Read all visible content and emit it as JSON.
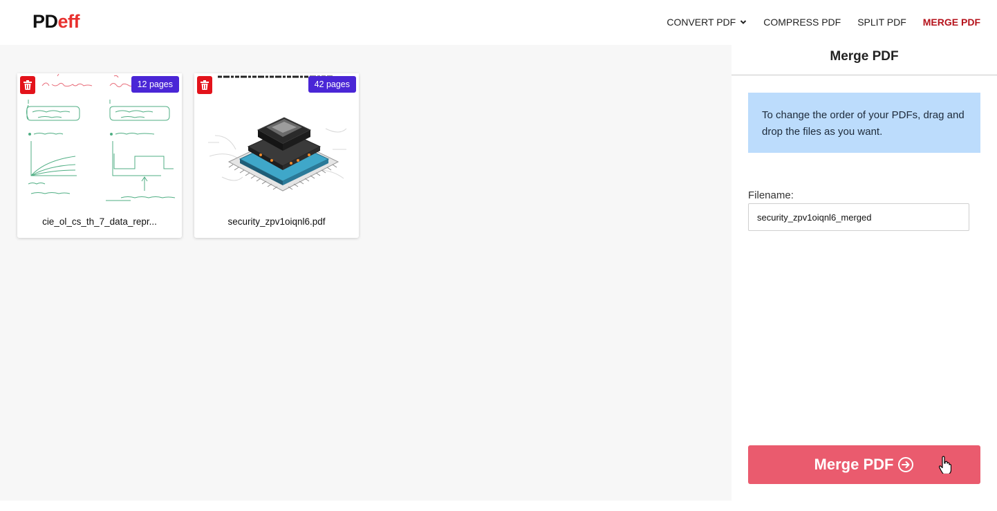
{
  "header": {
    "logo_pd": "PD",
    "logo_eff": "eff",
    "nav": [
      {
        "label": "CONVERT PDF",
        "has_dropdown": true
      },
      {
        "label": "COMPRESS PDF"
      },
      {
        "label": "SPLIT PDF"
      },
      {
        "label": "MERGE PDF",
        "active": true
      }
    ]
  },
  "files": [
    {
      "name": "cie_ol_cs_th_7_data_repr...",
      "pages": "12 pages",
      "thumbnail": "handwritten-notes"
    },
    {
      "name": "security_zpv1oiqnl6.pdf",
      "pages": "42 pages",
      "thumbnail": "cpu-chip-image",
      "thumb_title": "Topical Past Paper Questions (2014-2019)"
    }
  ],
  "panel": {
    "title": "Merge PDF",
    "info": "To change the order of your PDFs, drag and drop the files as you want.",
    "filename_label": "Filename:",
    "filename_value": "security_zpv1oiqnl6_merged",
    "merge_button": "Merge PDF"
  },
  "colors": {
    "accent": "#b5121b",
    "logo_red": "#e8312f",
    "badge": "#4a26d6",
    "delete": "#e3131b",
    "merge_button": "#ea5b6e",
    "info_bg": "#bcdcfc"
  }
}
